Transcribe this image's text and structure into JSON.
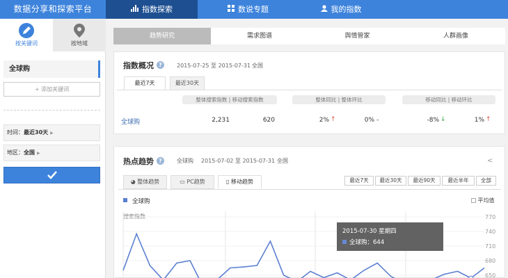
{
  "header": {
    "logo": "数据分享和探索平台",
    "nav": [
      {
        "label": "指数探索",
        "icon": "bar-chart-icon"
      },
      {
        "label": "数说专题",
        "icon": "grid-icon"
      },
      {
        "label": "我的指数",
        "icon": "user-icon"
      }
    ],
    "accent": "#3d83dc"
  },
  "sidebar": {
    "tabs": [
      {
        "label": "按关键词",
        "icon": "pen-icon"
      },
      {
        "label": "按地域",
        "icon": "location-pin-icon"
      }
    ],
    "keyword": "全球购",
    "add_keyword": "+ 添加关键词",
    "time_label": "时间：",
    "time_value": "最近30天",
    "region_label": "地区：",
    "region_value": "全国",
    "confirm_icon": "checkmark-icon"
  },
  "main_tabs": [
    "趋势研究",
    "需求图谱",
    "舆情管家",
    "人群画像"
  ],
  "overview": {
    "title": "指数概况",
    "date_range": "2015-07-25 至 2015-07-31",
    "region": "全国",
    "tabs": [
      "最近7天",
      "最近30天"
    ],
    "col_headers": {
      "overall": "整体搜索指数",
      "mobile": "移动搜索指数",
      "yoy": "整体同比",
      "mom": "整体环比",
      "m_yoy": "移动同比",
      "m_mom": "移动环比"
    },
    "row": {
      "keyword": "全球购",
      "overall": "2,231",
      "mobile": "620",
      "yoy": "2%",
      "mom": "0%",
      "mom_suffix": "-",
      "m_yoy": "-8%",
      "m_mom": "1%"
    }
  },
  "trend": {
    "title": "热点趋势",
    "keyword": "全球购",
    "date_range": "2015-07-02 至 2015-07-31",
    "region": "全国",
    "tabs": [
      "整体趋势",
      "PC趋势",
      "移动趋势"
    ],
    "range_buttons": [
      "最近7天",
      "最近30天",
      "最近90天",
      "最近半年",
      "全部"
    ],
    "legend": "全球购",
    "avg_label": "平均值",
    "y_label": "搜索指数",
    "tooltip": {
      "date": "2015-07-30 星期四",
      "series": "全球购：",
      "value": "644"
    }
  },
  "chart_data": {
    "type": "line",
    "title": "",
    "xlabel": "",
    "ylabel": "搜索指数",
    "ylim": [
      650,
      770
    ],
    "yticks": [
      "770",
      "740",
      "710",
      "680",
      "650"
    ],
    "series": [
      {
        "name": "全球购",
        "color": "#5b7fd1",
        "values": [
          660,
          735,
          670,
          640,
          675,
          680,
          625,
          640,
          665,
          667,
          670,
          720,
          650,
          637,
          658,
          645,
          655,
          640,
          660,
          675,
          648,
          633,
          626,
          640,
          652,
          658,
          644,
          665
        ]
      }
    ]
  }
}
